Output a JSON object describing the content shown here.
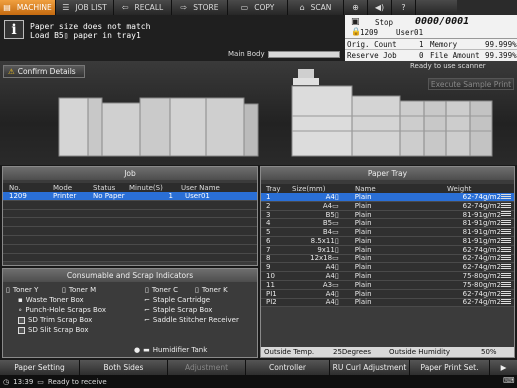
{
  "tabs": [
    {
      "label": "MACHINE",
      "icon": "machine-icon",
      "active": true
    },
    {
      "label": "JOB LIST",
      "icon": "list-icon",
      "active": false
    },
    {
      "label": "RECALL",
      "icon": "recall-icon",
      "active": false
    },
    {
      "label": "STORE",
      "icon": "store-icon",
      "active": false
    },
    {
      "label": "COPY",
      "icon": "copy-icon",
      "active": false
    },
    {
      "label": "SCAN",
      "icon": "scan-icon",
      "active": false
    }
  ],
  "message": {
    "line1": "Paper size does not match",
    "line2": "Load   B5▯      paper in tray1",
    "main_body_label": "Main Body"
  },
  "status": {
    "state": "Stop",
    "counter": "0000/0001",
    "job_number": "1209",
    "user": "User01",
    "orig_count_label": "Orig. Count",
    "orig_count": "1",
    "memory_label": "Memory",
    "memory": "99.999%",
    "reserve_job_label": "Reserve Job",
    "reserve_job": "0",
    "file_amount_label": "File Amount",
    "file_amount": "99.399%"
  },
  "machine": {
    "confirm_details": "Confirm Details",
    "ready_scanner": "Ready to use scanner",
    "execute_sample": "Execute Sample Print"
  },
  "job": {
    "title": "Job",
    "headers": [
      "No.",
      "Mode",
      "Status",
      "Minute(S)",
      "User Name"
    ],
    "rows": [
      {
        "no": "1209",
        "mode": "Printer",
        "status": "No Paper",
        "minutes": "1",
        "user": "User01"
      }
    ]
  },
  "consumables": {
    "title": "Consumable and Scrap Indicators",
    "items": {
      "toner_y": "Toner Y",
      "toner_m": "Toner M",
      "toner_c": "Toner C",
      "toner_k": "Toner K",
      "waste_toner": "Waste Toner Box",
      "staple_cartridge": "Staple Cartridge",
      "punch_hole": "Punch-Hole Scraps Box",
      "staple_scrap": "Staple Scrap Box",
      "sd_trim": "SD Trim Scrap Box",
      "saddle_stitcher": "Saddle Stitcher Receiver",
      "sd_slit": "SD Slit Scrap Box",
      "humidifier": "Humidifier Tank"
    }
  },
  "paper_tray": {
    "title": "Paper Tray",
    "headers": [
      "Tray",
      "Size(mm)",
      "Name",
      "Weight"
    ],
    "rows": [
      {
        "tray": "1",
        "size": "A4▯",
        "name": "Plain",
        "weight": "62-74g/m2",
        "selected": true
      },
      {
        "tray": "2",
        "size": "A4▭",
        "name": "Plain",
        "weight": "62-74g/m2",
        "selected": false
      },
      {
        "tray": "3",
        "size": "B5▯",
        "name": "Plain",
        "weight": "81-91g/m2",
        "selected": false
      },
      {
        "tray": "4",
        "size": "B5▭",
        "name": "Plain",
        "weight": "81-91g/m2",
        "selected": false
      },
      {
        "tray": "5",
        "size": "B4▭",
        "name": "Plain",
        "weight": "81-91g/m2",
        "selected": false
      },
      {
        "tray": "6",
        "size": "8.5x11▯",
        "name": "Plain",
        "weight": "81-91g/m2",
        "selected": false
      },
      {
        "tray": "7",
        "size": "9x11▯",
        "name": "Plain",
        "weight": "62-74g/m2",
        "selected": false
      },
      {
        "tray": "8",
        "size": "12x18▭",
        "name": "Plain",
        "weight": "62-74g/m2",
        "selected": false
      },
      {
        "tray": "9",
        "size": "A4▯",
        "name": "Plain",
        "weight": "62-74g/m2",
        "selected": false
      },
      {
        "tray": "10",
        "size": "A4▯",
        "name": "Plain",
        "weight": "75-80g/m2",
        "selected": false
      },
      {
        "tray": "11",
        "size": "A3▭",
        "name": "Plain",
        "weight": "75-80g/m2",
        "selected": false
      },
      {
        "tray": "PI1",
        "size": "A4▯",
        "name": "Plain",
        "weight": "62-74g/m2",
        "selected": false
      },
      {
        "tray": "PI2",
        "size": "A4▯",
        "name": "Plain",
        "weight": "62-74g/m2",
        "selected": false
      }
    ],
    "outside_temp_label": "Outside Temp.",
    "outside_temp": "25Degrees",
    "outside_humidity_label": "Outside Humidity",
    "outside_humidity": "50%"
  },
  "bottom_buttons": [
    {
      "label": "Paper Setting",
      "disabled": false
    },
    {
      "label": "Both Sides",
      "disabled": false
    },
    {
      "label": "Adjustment",
      "disabled": true
    },
    {
      "label": "Controller",
      "disabled": false
    },
    {
      "label": "RU Curl Adjustment",
      "disabled": false
    },
    {
      "label": "Paper Print Set.",
      "disabled": false
    }
  ],
  "footer": {
    "time": "13:39",
    "status": "Ready to receive"
  },
  "colors": {
    "accent_tab": "#e08a28",
    "selection": "#2a6fd6",
    "status_panel": "#f2f2f2"
  }
}
